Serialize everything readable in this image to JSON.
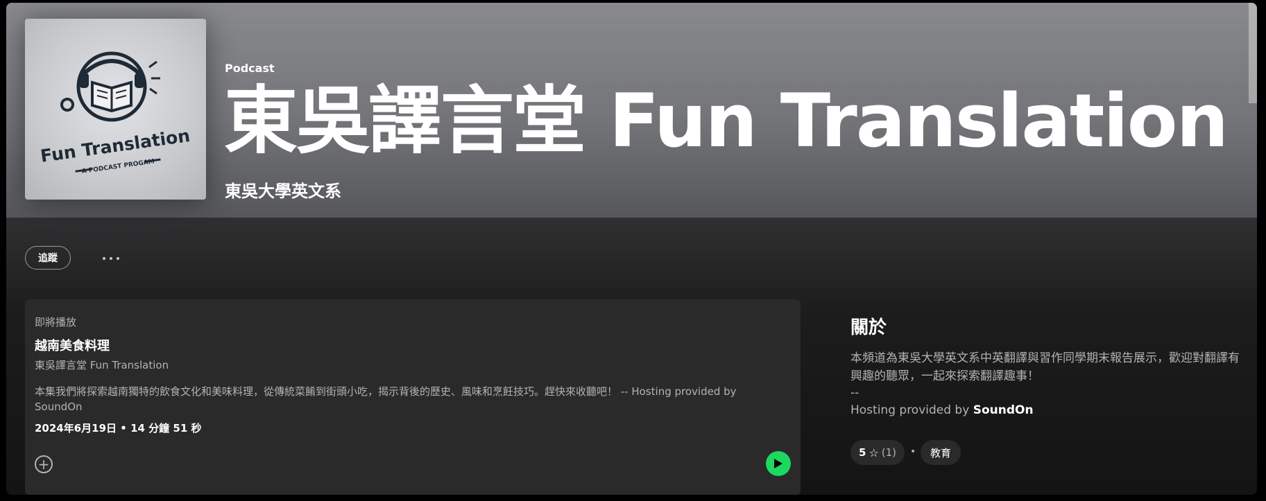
{
  "header": {
    "type_label": "Podcast",
    "title": "東吳譯言堂 Fun Translation",
    "publisher": "東吳大學英文系"
  },
  "cover": {
    "logo_title": "Fun Translation",
    "logo_subtitle": "A PODCAST PROGAM",
    "icon": "open-book-headphones-globe-icon"
  },
  "actions": {
    "follow_label": "追蹤",
    "more_icon": "more-options-icon"
  },
  "episode": {
    "upnext_label": "即將播放",
    "title": "越南美食料理",
    "show": "東吳譯言堂 Fun Translation",
    "description": "本集我們將探索越南獨特的飲食文化和美味料理，從傳統菜餚到街頭小吃，揭示背後的歷史、風味和烹飪技巧。趕快來收聽吧！ -- Hosting provided by SoundOn",
    "meta": "2024年6月19日 • 14 分鐘 51 秒",
    "add_icon": "add-circle-icon",
    "play_icon": "play-icon",
    "play_color": "#1ed760"
  },
  "about": {
    "heading": "關於",
    "description": "本頻道為東吳大學英文系中英翻譯與習作同學期末報告展示，歡迎對翻譯有興趣的聽眾，一起來探索翻譯趣事！",
    "separator": "--",
    "hosting_prefix": "Hosting provided by ",
    "hosting_name": "SoundOn",
    "rating_value": "5",
    "rating_star": "☆",
    "rating_count": "(1)",
    "dot": "•",
    "category": "教育"
  }
}
